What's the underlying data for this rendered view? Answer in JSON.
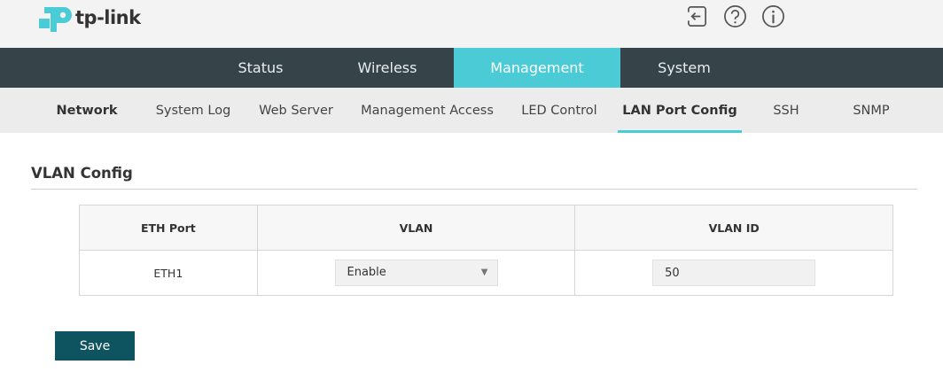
{
  "header": {
    "brand": "tp-link",
    "icons": [
      "logout-icon",
      "help-icon",
      "info-icon"
    ]
  },
  "main_nav": {
    "tabs": [
      {
        "label": "Status",
        "active": false
      },
      {
        "label": "Wireless",
        "active": false
      },
      {
        "label": "Management",
        "active": true
      },
      {
        "label": "System",
        "active": false
      }
    ]
  },
  "sub_nav": {
    "items": [
      {
        "label": "Network"
      },
      {
        "label": "System Log"
      },
      {
        "label": "Web Server"
      },
      {
        "label": "Management Access"
      },
      {
        "label": "LED Control"
      },
      {
        "label": "LAN Port Config",
        "active": true
      },
      {
        "label": "SSH"
      },
      {
        "label": "SNMP"
      }
    ]
  },
  "section": {
    "title": "VLAN Config"
  },
  "table": {
    "headers": [
      "ETH Port",
      "VLAN",
      "VLAN ID"
    ],
    "rows": [
      {
        "port": "ETH1",
        "vlan": "Enable",
        "vlan_id": "50"
      }
    ]
  },
  "actions": {
    "save_label": "Save"
  },
  "colors": {
    "accent": "#4acbd6",
    "nav_bg": "#36444a",
    "button": "#0d5460",
    "brand": "#4acbd6"
  }
}
